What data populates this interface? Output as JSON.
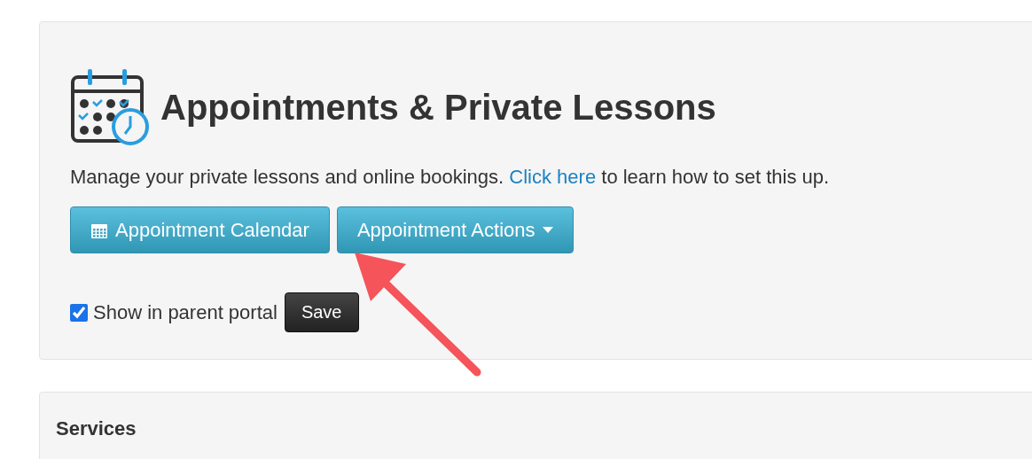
{
  "panel": {
    "title": "Appointments & Private Lessons",
    "description": {
      "before": "Manage your private lessons and online bookings.",
      "link": "Click here",
      "after": "to learn how to set this up."
    },
    "buttons": [
      {
        "label": "Appointment Calendar",
        "kind": "calendar"
      },
      {
        "label": "Appointment Actions",
        "kind": "dropdown"
      }
    ],
    "portal": {
      "label": "Show in parent portal",
      "checked": true
    },
    "save": "Save"
  },
  "services": {
    "title": "Services"
  }
}
